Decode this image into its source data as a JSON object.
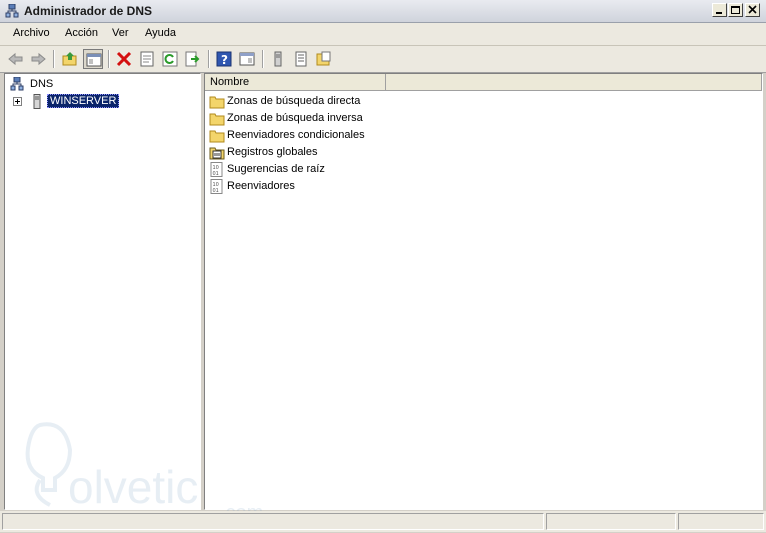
{
  "window": {
    "title": "Administrador de DNS"
  },
  "menu": [
    "Archivo",
    "Acción",
    "Ver",
    "Ayuda"
  ],
  "toolbar": {
    "buttons": [
      "back-icon",
      "forward-icon",
      "up-folder-icon",
      "show-tree-icon",
      "delete-icon",
      "properties-icon",
      "refresh-icon",
      "export-icon",
      "help-icon",
      "console-icon",
      "server-icon",
      "list-icon",
      "folder-options-icon"
    ]
  },
  "tree": {
    "root": "DNS",
    "server": "WINSERVER"
  },
  "list": {
    "column": "Nombre",
    "items": [
      {
        "label": "Zonas de búsqueda directa",
        "icon": "folder-icon"
      },
      {
        "label": "Zonas de búsqueda inversa",
        "icon": "folder-icon"
      },
      {
        "label": "Reenviadores condicionales",
        "icon": "folder-icon"
      },
      {
        "label": "Registros globales",
        "icon": "global-records-icon"
      },
      {
        "label": "Sugerencias de raíz",
        "icon": "binary-file-icon"
      },
      {
        "label": "Reenviadores",
        "icon": "binary-file-icon"
      }
    ]
  },
  "watermark": {
    "text": "olvetic",
    "suffix": ".com"
  },
  "colors": {
    "selection": "#0a246a",
    "folder": "#f3d56b"
  }
}
